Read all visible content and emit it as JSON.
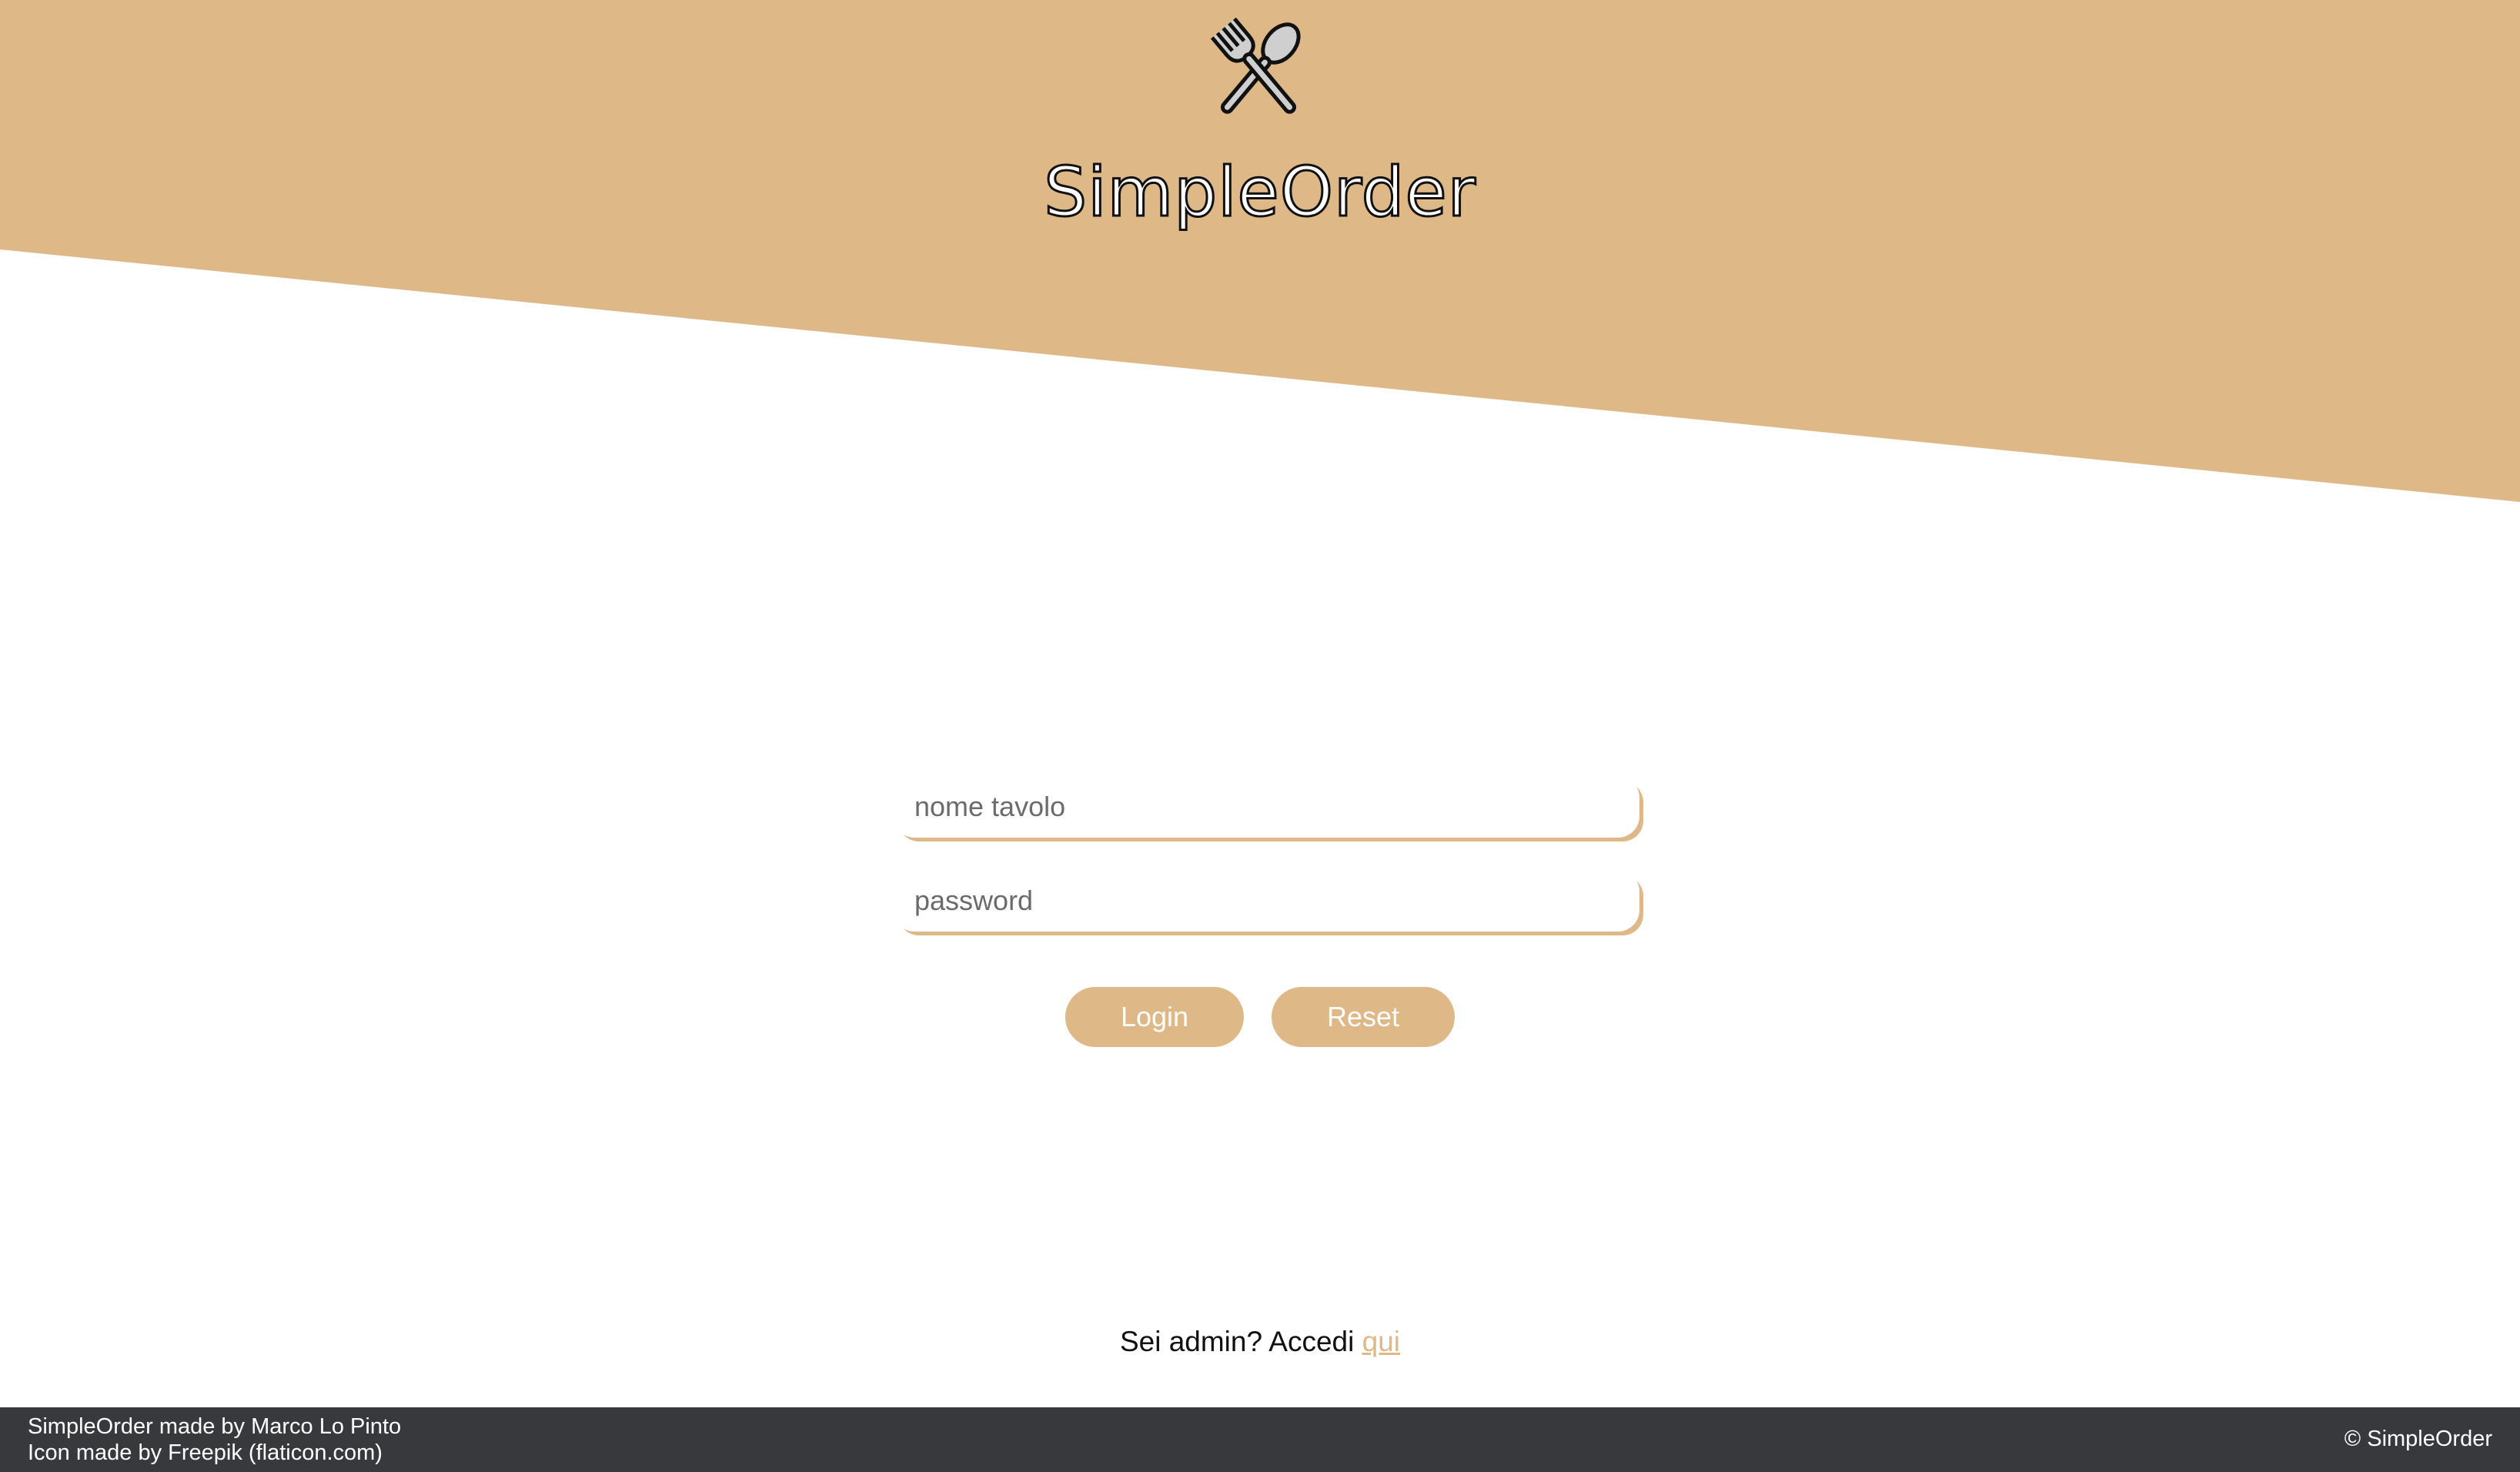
{
  "colors": {
    "accent": "#dfb887",
    "footer_bg": "#38393d",
    "text": "#111111"
  },
  "header": {
    "title": "SimpleOrder",
    "logo_icon": "fork-spoon-crossed-icon"
  },
  "login_form": {
    "table_name_placeholder": "nome tavolo",
    "password_placeholder": "password",
    "login_label": "Login",
    "reset_label": "Reset"
  },
  "admin": {
    "prompt": "Sei admin? Accedi ",
    "link_label": "qui"
  },
  "footer": {
    "credit_line_1": "SimpleOrder made by Marco Lo Pinto",
    "credit_line_2": "Icon made by Freepik (flaticon.com)",
    "copyright": "© SimpleOrder"
  }
}
